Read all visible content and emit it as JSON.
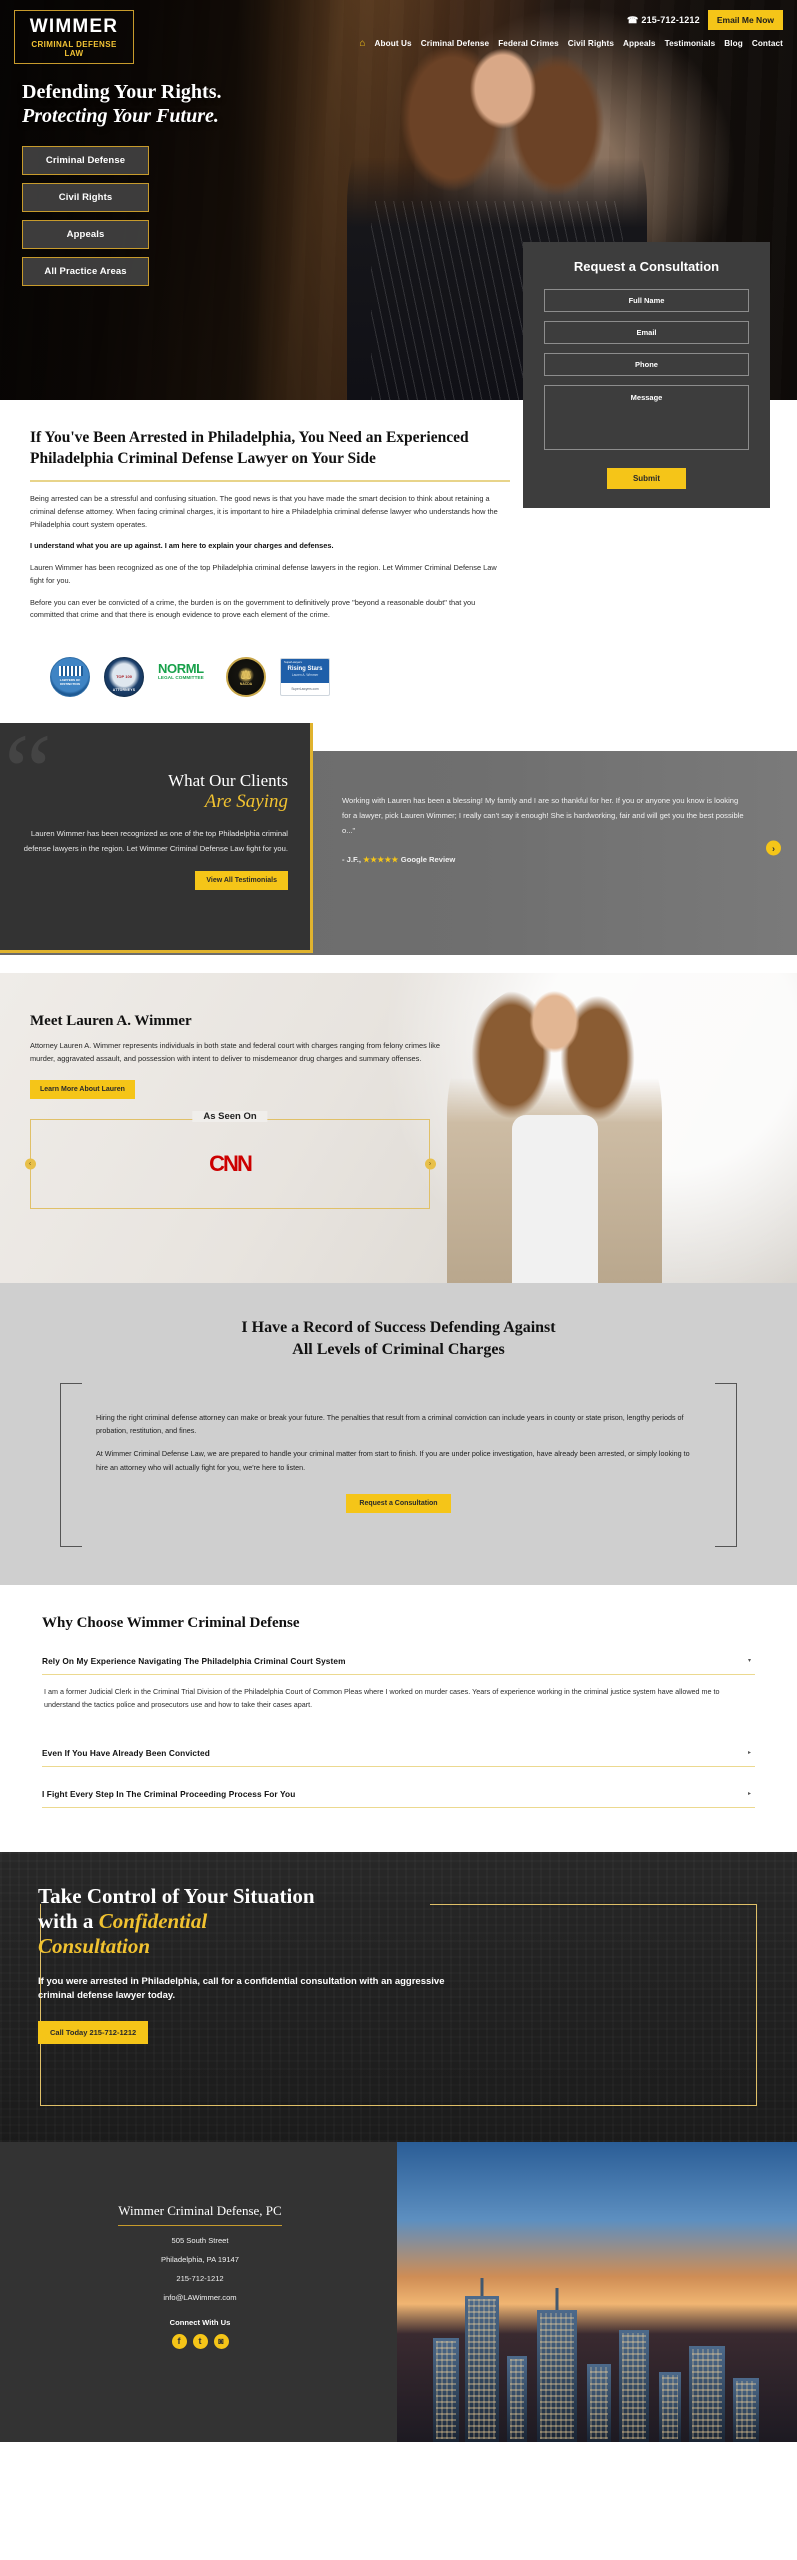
{
  "header": {
    "logo_top": "WIMMER",
    "logo_bottom": "CRIMINAL DEFENSE LAW",
    "phone": "215-712-1212",
    "email_button": "Email Me Now",
    "nav": [
      {
        "label": "About Us"
      },
      {
        "label": "Criminal Defense"
      },
      {
        "label": "Federal Crimes"
      },
      {
        "label": "Civil Rights"
      },
      {
        "label": "Appeals"
      },
      {
        "label": "Testimonials"
      },
      {
        "label": "Blog"
      },
      {
        "label": "Contact"
      }
    ]
  },
  "hero": {
    "line1": "Defending Your Rights.",
    "line2": "Protecting Your Future.",
    "buttons": [
      {
        "label": "Criminal Defense"
      },
      {
        "label": "Civil Rights"
      },
      {
        "label": "Appeals"
      },
      {
        "label": "All Practice Areas"
      }
    ]
  },
  "consult": {
    "title": "Request a Consultation",
    "full_name_placeholder": "Full Name",
    "email_placeholder": "Email",
    "phone_placeholder": "Phone",
    "message_placeholder": "Message",
    "submit_label": "Submit"
  },
  "intro": {
    "heading": "If You've Been Arrested in Philadelphia, You Need an Experienced Philadelphia Criminal Defense Lawyer on Your Side",
    "p1": "Being arrested can be a stressful and confusing situation. The good news is that you have made the smart decision to think about retaining a criminal defense attorney. When facing criminal charges, it is important to hire a Philadelphia criminal defense lawyer who understands how the Philadelphia court system operates.",
    "p2": "I understand what you are up against. I am here to explain your charges and defenses.",
    "p3": "Lauren Wimmer has been recognized as one of the top Philadelphia criminal defense lawyers in the region. Let Wimmer Criminal Defense Law fight for you.",
    "p4": "Before you can ever be convicted of a crime, the burden is on the government to definitively prove \"beyond a reasonable doubt\" that you committed that crime and that there is enough evidence to prove each element of the crime."
  },
  "badges": [
    {
      "name": "lawyers-of-distinction",
      "text": "LAWYERS OF DISTINCTION"
    },
    {
      "name": "top-100-attorneys",
      "text": "TOP 100 ATTORNEYS"
    },
    {
      "name": "norml-legal-committee",
      "top": "NORML",
      "bottom": "LEGAL COMMITTEE"
    },
    {
      "name": "nacda",
      "text": "NACDA"
    },
    {
      "name": "rising-stars",
      "l1": "SuperLawyers",
      "l2": "Rising Stars",
      "l3": "Lauren A. Wimmer",
      "l4": "SuperLawyers.com"
    }
  ],
  "testimonials": {
    "heading_line1": "What Our Clients",
    "heading_line2": "Are Saying",
    "blurb": "Lauren Wimmer has been recognized as one of the top Philadelphia criminal defense lawyers in the region. Let Wimmer Criminal Defense Law fight for you.",
    "button_label": "View All Testimonials",
    "quote": "Working with Lauren has been a blessing! My family and I are so thankful for her. If you or anyone you know is looking for a lawyer, pick Lauren Wimmer; I really can't say it enough! She is hardworking, fair and will get you the best possible o...\"",
    "attribution_prefix": "- J.F.,",
    "stars": "★★★★★",
    "attribution_suffix": "Google Review",
    "next_arrow": "›"
  },
  "meet": {
    "heading": "Meet Lauren A. Wimmer",
    "body": "Attorney Lauren A. Wimmer represents individuals in both state and federal court with charges ranging from felony crimes like murder, aggravated assault, and possession with intent to deliver to misdemeanor drug charges and summary offenses.",
    "button_label": "Learn More About Lauren",
    "seen_on_label": "As Seen On",
    "media_logo": "CNN",
    "prev_arrow": "‹",
    "next_arrow": "›"
  },
  "record": {
    "heading_line1": "I Have a Record of Success Defending Against",
    "heading_line2": "All Levels of Criminal Charges",
    "p1": "Hiring the right criminal defense attorney can make or break your future. The penalties that result from a criminal conviction can include years in county or state prison, lengthy periods of probation, restitution, and fines.",
    "p2": "At Wimmer Criminal Defense Law, we are prepared to handle your criminal matter from start to finish. If you are under police investigation, have already been arrested, or simply looking to hire an attorney who will actually fight for you, we're here to listen.",
    "button_label": "Request a Consultation"
  },
  "why": {
    "heading": "Why Choose Wimmer Criminal Defense",
    "items": [
      {
        "title": "Rely On My Experience Navigating The Philadelphia Criminal Court System",
        "body": "I am a former Judicial Clerk in the Criminal Trial Division of the Philadelphia Court of Common Pleas where I worked on murder cases. Years of experience working in the criminal justice system have allowed me to understand the tactics police and prosecutors use and how to take their cases apart.",
        "caret": "▾",
        "open": true
      },
      {
        "title": "Even If You Have Already Been Convicted",
        "body": "",
        "caret": "▸",
        "open": false
      },
      {
        "title": "I Fight Every Step In The Criminal Proceeding Process For You",
        "body": "",
        "caret": "▸",
        "open": false
      }
    ]
  },
  "cta": {
    "line1": "Take Control of Your Situation",
    "line2_plain": "with a ",
    "line2_gold": "Confidential",
    "line3_gold": "Consultation",
    "body": "If you were arrested in Philadelphia, call for a confidential consultation with an aggressive criminal defense lawyer today.",
    "button_label": "Call Today 215-712-1212"
  },
  "footer": {
    "title": "Wimmer Criminal Defense, PC",
    "address_line1": "505 South Street",
    "address_line2": "Philadelphia, PA 19147",
    "phone": "215-712-1212",
    "email": "info@LAWimmer.com",
    "connect_label": "Connect With Us",
    "socials": [
      {
        "name": "facebook-icon",
        "glyph": "f"
      },
      {
        "name": "twitter-icon",
        "glyph": "t"
      },
      {
        "name": "instagram-icon",
        "glyph": "◙"
      }
    ]
  },
  "colors": {
    "gold": "#f5c518",
    "gold_border": "#c79b2c",
    "dark": "#333333"
  }
}
